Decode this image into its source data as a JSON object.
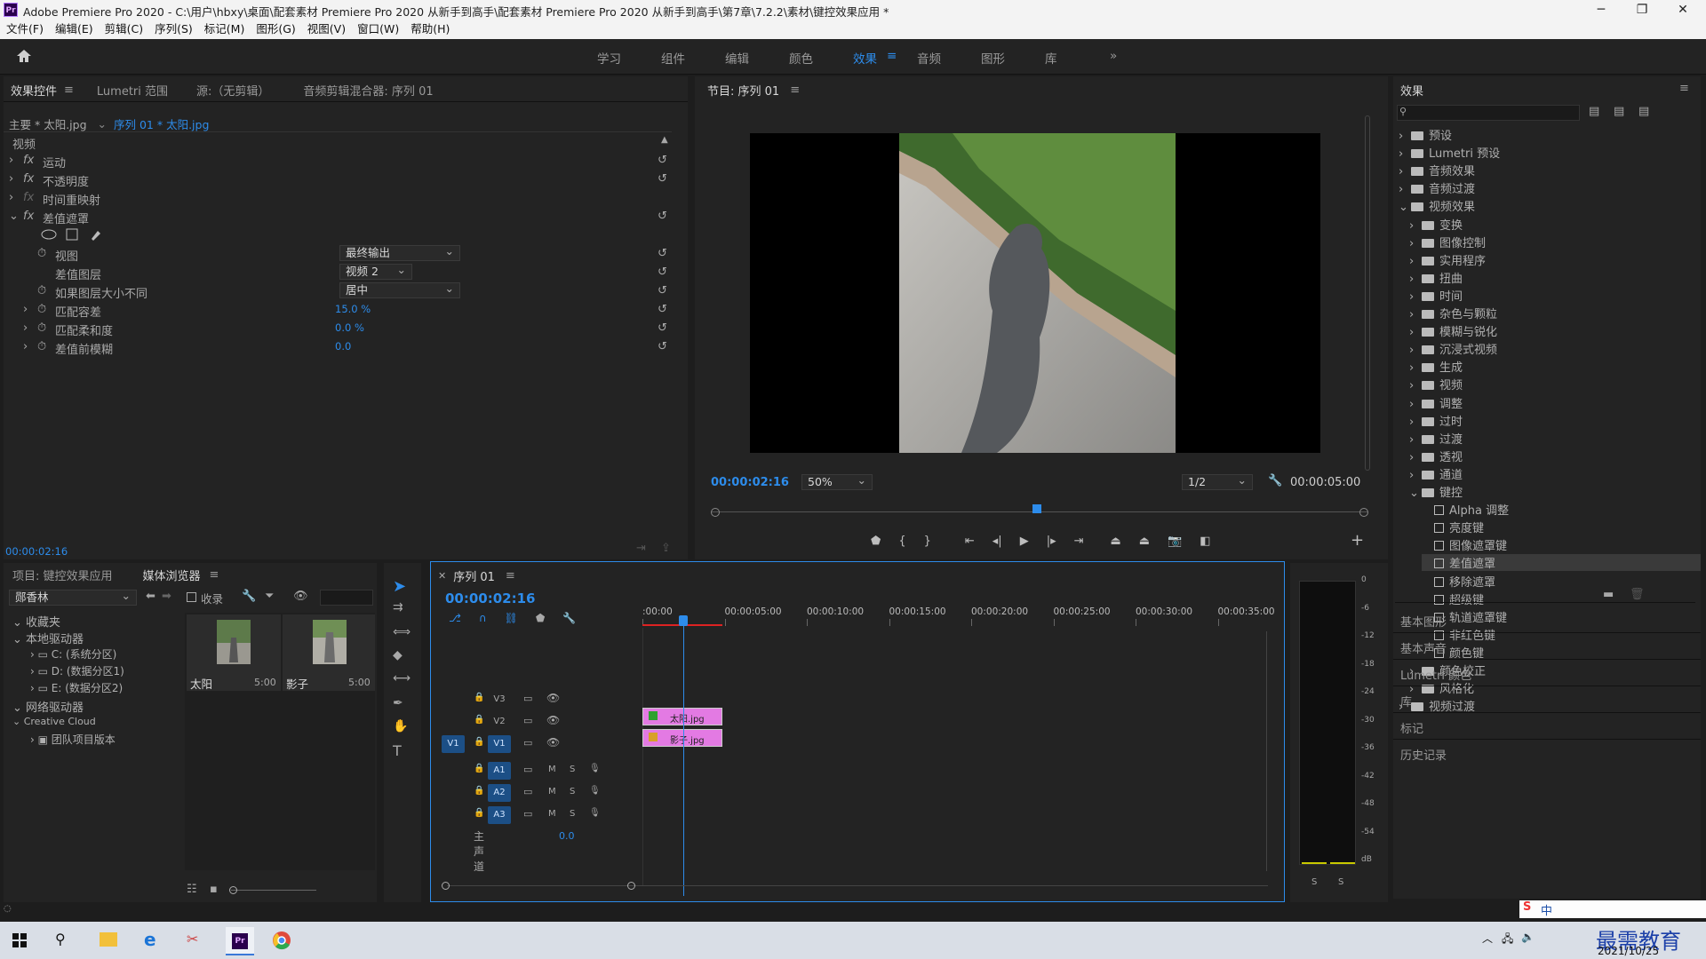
{
  "window": {
    "title": "Adobe Premiere Pro 2020 - C:\\用户\\hbxy\\桌面\\配套素材 Premiere Pro 2020 从新手到高手\\配套素材 Premiere Pro 2020 从新手到高手\\第7章\\7.2.2\\素材\\键控效果应用 *",
    "app_badge": "Pr"
  },
  "menu": [
    "文件(F)",
    "编辑(E)",
    "剪辑(C)",
    "序列(S)",
    "标记(M)",
    "图形(G)",
    "视图(V)",
    "窗口(W)",
    "帮助(H)"
  ],
  "workspaces": [
    "学习",
    "组件",
    "编辑",
    "颜色",
    "效果",
    "音频",
    "图形",
    "库"
  ],
  "workspace_active": "效果",
  "effect_controls": {
    "tabs": [
      "效果控件",
      "Lumetri 范围",
      "源:（无剪辑）",
      "音频剪辑混合器: 序列 01"
    ],
    "master": "主要 * 太阳.jpg",
    "clip": "序列 01 * 太阳.jpg",
    "section": "视频",
    "fx_items": [
      "运动",
      "不透明度",
      "时间重映射",
      "差值遮罩"
    ],
    "props": {
      "view_label": "视图",
      "view_value": "最终输出",
      "layer_label": "差值图层",
      "layer_value": "视频 2",
      "size_label": "如果图层大小不同",
      "size_value": "居中",
      "tolerance_label": "匹配容差",
      "tolerance_value": "15.0 %",
      "softness_label": "匹配柔和度",
      "softness_value": "0.0 %",
      "blur_label": "差值前模糊",
      "blur_value": "0.0"
    },
    "timecode": "00:00:02:16"
  },
  "program": {
    "title": "节目: 序列 01",
    "timecode": "00:00:02:16",
    "zoom": "50%",
    "quality": "1/2",
    "duration": "00:00:05:00"
  },
  "effects_panel": {
    "title": "效果",
    "top": [
      "预设",
      "Lumetri 预设",
      "音频效果",
      "音频过渡",
      "视频效果"
    ],
    "video_effects": [
      "变换",
      "图像控制",
      "实用程序",
      "扭曲",
      "时间",
      "杂色与颗粒",
      "模糊与锐化",
      "沉浸式视频",
      "生成",
      "视频",
      "调整",
      "过时",
      "过渡",
      "透视",
      "通道",
      "键控"
    ],
    "keying": [
      "Alpha 调整",
      "亮度键",
      "图像遮罩键",
      "差值遮罩",
      "移除遮罩",
      "超级键",
      "轨道遮罩键",
      "非红色键",
      "颜色键"
    ],
    "keying_selected": "差值遮罩",
    "after": [
      "颜色校正",
      "风格化"
    ],
    "last": "视频过渡",
    "panels": [
      "基本图形",
      "基本声音",
      "Lumetri 颜色",
      "库",
      "标记",
      "历史记录"
    ]
  },
  "project": {
    "tabs": [
      "项目: 键控效果应用",
      "媒体浏览器"
    ],
    "location": "郧香林",
    "collect": "收录",
    "tree": {
      "favorites": "收藏夹",
      "local": "本地驱动器",
      "c": "C: (系统分区)",
      "d": "D: (数据分区1)",
      "e": "E: (数据分区2)",
      "net": "网络驱动器",
      "cc": "Creative Cloud",
      "team": "团队项目版本"
    },
    "items": [
      {
        "name": "太阳",
        "dur": "5:00"
      },
      {
        "name": "影子",
        "dur": "5:00"
      }
    ]
  },
  "timeline": {
    "title": "序列 01",
    "timecode": "00:00:02:16",
    "ruler": [
      ":00:00",
      "00:00:05:00",
      "00:00:10:00",
      "00:00:15:00",
      "00:00:20:00",
      "00:00:25:00",
      "00:00:30:00",
      "00:00:35:00"
    ],
    "tracks": [
      "V3",
      "V2",
      "V1",
      "A1",
      "A2",
      "A3"
    ],
    "src_v1": "V1",
    "master": "主声道",
    "master_val": "0.0",
    "clip_v2": "太阳.jpg",
    "clip_v1": "影子.jpg",
    "mute": "M",
    "solo": "S"
  },
  "meter": {
    "scale": [
      "0",
      "-6",
      "-12",
      "-18",
      "-24",
      "-30",
      "-36",
      "-42",
      "-48",
      "-54",
      "dB"
    ],
    "solo": [
      "S",
      "S"
    ]
  },
  "taskbar": {
    "date": "2021/10/25",
    "brand": "最需教育",
    "ime": "中"
  }
}
